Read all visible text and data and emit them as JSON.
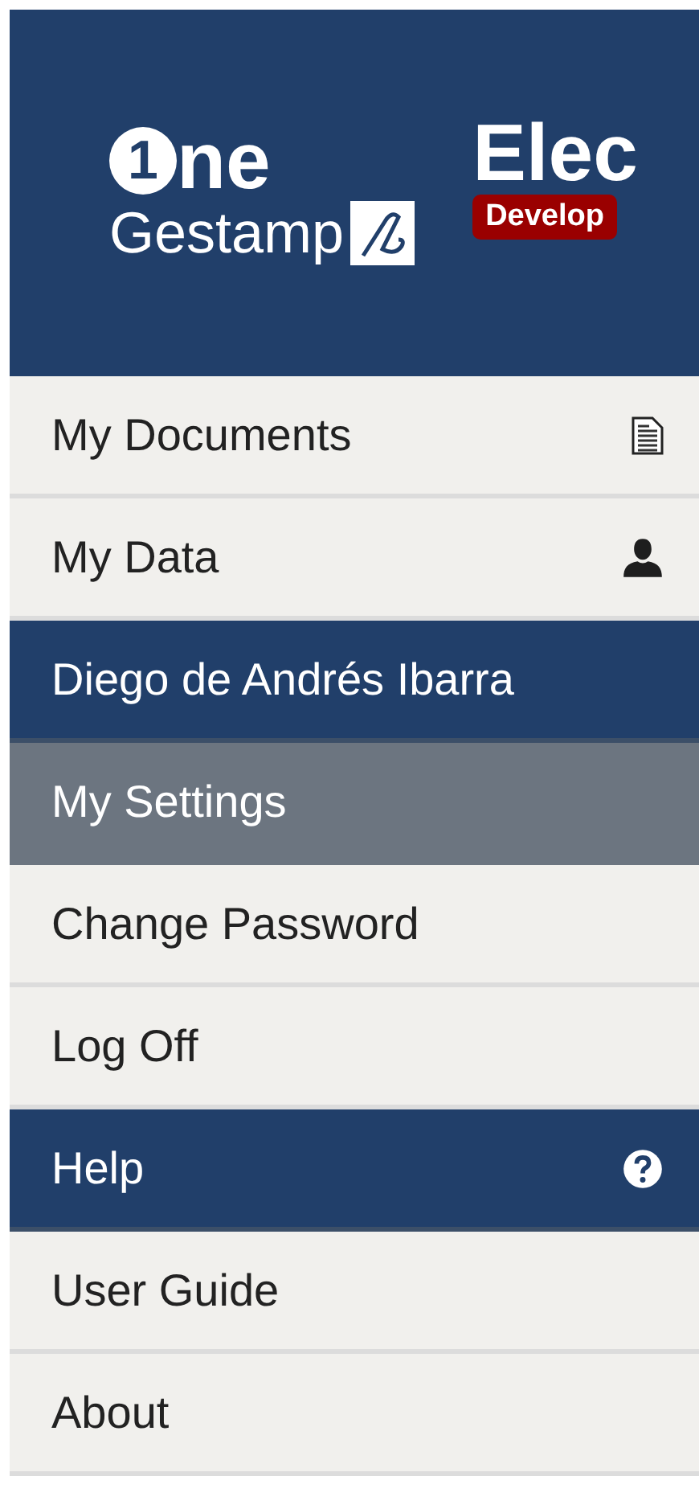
{
  "header": {
    "logo": {
      "mark": "1",
      "word": "ne",
      "name": "Gestamp"
    },
    "app_title": "Elec",
    "badge": "Develop"
  },
  "menu": [
    {
      "kind": "doclink",
      "label": "My Documents",
      "selected": false
    },
    {
      "kind": "userlink",
      "label": "My Data",
      "selected": false
    },
    {
      "kind": "section",
      "label": "Diego de Andrés Ibarra"
    },
    {
      "kind": "link",
      "label": "My Settings",
      "selected": true
    },
    {
      "kind": "link",
      "label": "Change Password",
      "selected": false
    },
    {
      "kind": "link",
      "label": "Log Off",
      "selected": false
    },
    {
      "kind": "helpsection",
      "label": "Help"
    },
    {
      "kind": "link",
      "label": "User Guide",
      "selected": false
    },
    {
      "kind": "link",
      "label": "About",
      "selected": false
    }
  ]
}
